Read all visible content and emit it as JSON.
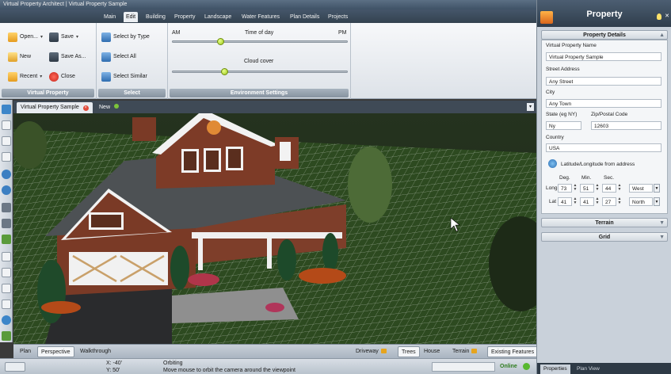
{
  "window": {
    "title": "Virtual Property Architect | Virtual Property Sample"
  },
  "menu_tabs": [
    "Main",
    "Edit",
    "Building",
    "Property",
    "Landscape",
    "Water Features",
    "Plan Details",
    "Projects"
  ],
  "menu_active": "Edit",
  "ribbon": {
    "virtual_property": {
      "label": "Virtual Property",
      "open": "Open...",
      "save": "Save",
      "new": "New",
      "save_as": "Save As...",
      "recent": "Recent",
      "close": "Close"
    },
    "select": {
      "label": "Select",
      "select_by_type": "Select by Type",
      "select_all": "Select All",
      "select_similar": "Select Similar"
    },
    "environment": {
      "label": "Environment Settings",
      "am": "AM",
      "pm": "PM",
      "time_of_day": "Time of day",
      "cloud_cover": "Cloud cover",
      "time_value": 0.28,
      "cloud_value": 0.3
    }
  },
  "doc_tabs": {
    "active": "Virtual Property Sample",
    "new": "New"
  },
  "view_tabs": {
    "plan": "Plan",
    "perspective": "Perspective",
    "walkthrough": "Walkthrough"
  },
  "layer_toggles": {
    "driveway": "Driveway",
    "trees": "Trees",
    "house": "House",
    "terrain": "Terrain",
    "existing": "Existing Features"
  },
  "status": {
    "x": "X:  -40'",
    "y": "Y:  50'",
    "mode": "Orbiting",
    "hint": "Move mouse to orbit the camera around the viewpoint",
    "online": "Online"
  },
  "panel": {
    "title": "Property",
    "details_header": "Property Details",
    "name_label": "Virtual Property Name",
    "name_value": "Virtual Property Sample",
    "street_label": "Street Address",
    "street_value": "Any Street",
    "city_label": "City",
    "city_value": "Any Town",
    "state_label": "State (eg NY)",
    "state_value": "Ny",
    "zip_label": "Zip/Postal Code",
    "zip_value": "12603",
    "country_label": "Country",
    "country_value": "USA",
    "latlong_link": "Latitude/Longitude from address",
    "deg": "Deg.",
    "min": "Min.",
    "sec": "Sec.",
    "long_label": "Long",
    "long_deg": "73",
    "long_min": "51",
    "long_sec": "44",
    "long_dir": "West",
    "lat_label": "Lat",
    "lat_deg": "41",
    "lat_min": "41",
    "lat_sec": "27",
    "lat_dir": "North",
    "terrain_header": "Terrain",
    "grid_header": "Grid",
    "bottom_tabs": [
      "Properties",
      "Plan View"
    ]
  },
  "colors": {
    "accent": "#9cc81a",
    "ribbon_bg": "#eef1f4",
    "grass": "#2f4b22",
    "grid": "#ffffff"
  }
}
